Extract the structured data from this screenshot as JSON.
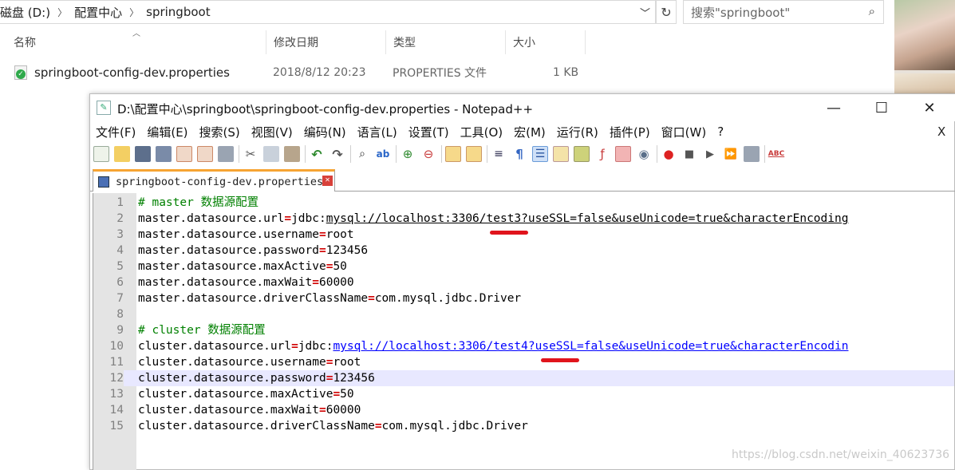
{
  "explorer": {
    "breadcrumb": [
      "磁盘 (D:)",
      "配置中心",
      "springboot"
    ],
    "search_placeholder": "搜索\"springboot\"",
    "columns": [
      "名称",
      "修改日期",
      "类型",
      "大小"
    ],
    "file": {
      "name": "springboot-config-dev.properties",
      "modified": "2018/8/12 20:23",
      "type": "PROPERTIES 文件",
      "size": "1 KB"
    }
  },
  "notepad": {
    "title": "D:\\配置中心\\springboot\\springboot-config-dev.properties - Notepad++",
    "window_buttons": {
      "minimize": "—",
      "maximize": "☐",
      "close": "✕"
    },
    "menu": [
      "文件(F)",
      "编辑(E)",
      "搜索(S)",
      "视图(V)",
      "编码(N)",
      "语言(L)",
      "设置(T)",
      "工具(O)",
      "宏(M)",
      "运行(R)",
      "插件(P)",
      "窗口(W)",
      "?"
    ],
    "menu_close": "X",
    "tab_label": "springboot-config-dev.properties",
    "highlighted_line": 12,
    "lines": [
      {
        "n": "1",
        "comment": "# master 数据源配置"
      },
      {
        "n": "2",
        "key": "master.datasource.url",
        "value_prefix": "jdbc:",
        "value_link": "mysql://localhost:3306/test3?useSSL=false&useUnicode=true&characterEncoding",
        "link_style": "dark"
      },
      {
        "n": "3",
        "key": "master.datasource.username",
        "value": "root"
      },
      {
        "n": "4",
        "key": "master.datasource.password",
        "value": "123456"
      },
      {
        "n": "5",
        "key": "master.datasource.maxActive",
        "value": "50"
      },
      {
        "n": "6",
        "key": "master.datasource.maxWait",
        "value": "60000"
      },
      {
        "n": "7",
        "key": "master.datasource.driverClassName",
        "value": "com.mysql.jdbc.Driver"
      },
      {
        "n": "8"
      },
      {
        "n": "9",
        "comment": "# cluster 数据源配置"
      },
      {
        "n": "10",
        "key": "cluster.datasource.url",
        "value_prefix": "jdbc:",
        "value_link": "mysql://localhost:3306/test4?useSSL=false&useUnicode=true&characterEncodin",
        "link_style": "blue"
      },
      {
        "n": "11",
        "key": "cluster.datasource.username",
        "value": "root"
      },
      {
        "n": "12",
        "key": "cluster.datasource.password",
        "value": "123456"
      },
      {
        "n": "13",
        "key": "cluster.datasource.maxActive",
        "value": "50"
      },
      {
        "n": "14",
        "key": "cluster.datasource.maxWait",
        "value": "60000"
      },
      {
        "n": "15",
        "key": "cluster.datasource.driverClassName",
        "value": "com.mysql.jdbc.Driver"
      }
    ],
    "equals": "="
  },
  "watermark": "https://blog.csdn.net/weixin_40623736",
  "colors": {
    "accent_tab": "#f7a432",
    "comment": "#008000",
    "operator": "#d00000",
    "link": "#0000ff",
    "annotation": "#e0141c"
  }
}
